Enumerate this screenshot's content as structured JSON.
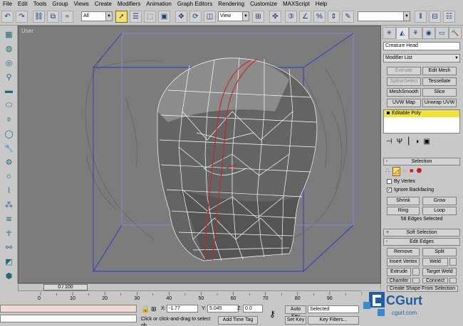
{
  "menu": [
    "File",
    "Edit",
    "Tools",
    "Group",
    "Views",
    "Create",
    "Modifiers",
    "Animation",
    "Graph Editors",
    "Rendering",
    "Customize",
    "MAXScript",
    "Help"
  ],
  "toolbar": {
    "selection_filter": "All",
    "ref_coord": "View"
  },
  "viewport": {
    "label": "User"
  },
  "command_panel": {
    "object_name": "Creature Head",
    "modifier_list": "Modifier List",
    "buttons": [
      "Extrude",
      "Edit Mesh",
      "SplineSelect",
      "Tessellate",
      "MeshSmooth",
      "Slice",
      "UVW Map",
      "Unwrap UVW"
    ],
    "stack_item": "Editable Poly",
    "selection_rollout": "Selection",
    "by_vertex": "By Vertex",
    "ignore_backfacing": "Ignore Backfacing",
    "shrink": "Shrink",
    "grow": "Grow",
    "ring": "Ring",
    "loop": "Loop",
    "edges_selected": "58 Edges Selected",
    "soft_selection": "Soft Selection",
    "edit_edges": "Edit Edges",
    "remove": "Remove",
    "split": "Split",
    "insert_vertex": "Insert Vertex",
    "weld": "Weld",
    "extrude": "Extrude",
    "target_weld": "Target Weld",
    "chamfer": "Chamfer",
    "connect": "Connect",
    "create_shape": "Create Shape From Selection"
  },
  "time": {
    "slider": "0 / 100",
    "ticks": [
      "0",
      "10",
      "20",
      "30",
      "40",
      "50",
      "60",
      "70",
      "80",
      "90"
    ]
  },
  "status": {
    "x_label": "X:",
    "x_value": "-1.77",
    "y_label": "Y:",
    "y_value": "5.045",
    "z_label": "Z:",
    "z_value": "0.0",
    "prompt": "Click or click-and-drag to select ob",
    "add_time_tag": "Add Time Tag",
    "auto_key": "Auto Key",
    "set_key": "Set Key",
    "selected": "Selected",
    "key_filters": "Key Filters..."
  },
  "watermark": {
    "brand": "CGurt",
    "url": "cgurt.com"
  },
  "colors": {
    "viewport_bg": "#7c7c7c",
    "wire": "#ffffff",
    "selected_edges": "#d02020",
    "bbox": "#3232c8",
    "active_button": "#f4e070"
  }
}
